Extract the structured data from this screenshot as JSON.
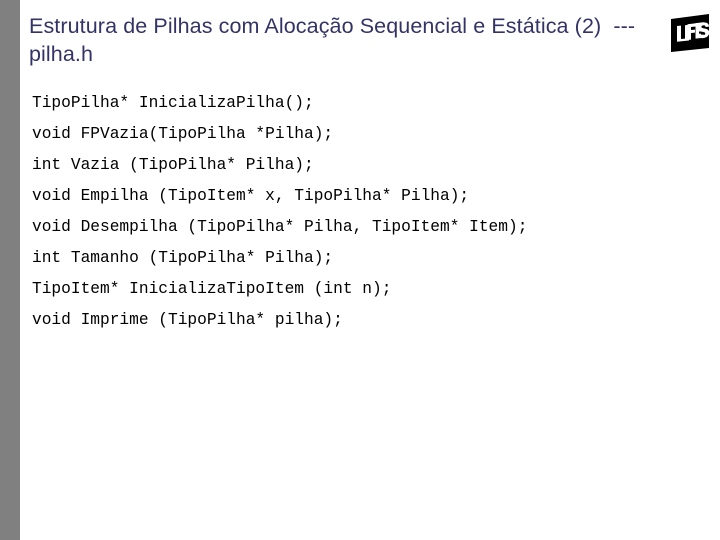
{
  "slide": {
    "title": "Estrutura de Pilhas com Alocação Sequencial e Estática (2)  --- pilha.h",
    "title_color": "#333366",
    "band_color": "#808080",
    "background_color": "#ffffff",
    "code_color": "#000000"
  },
  "logo": {
    "name": "ufes-logo",
    "text": "UFES"
  },
  "code": {
    "lines": [
      "TipoPilha* InicializaPilha();",
      "void FPVazia(TipoPilha *Pilha);",
      "int Vazia (TipoPilha* Pilha);",
      "void Empilha (TipoItem* x, TipoPilha* Pilha);",
      "void Desempilha (TipoPilha* Pilha, TipoItem* Item);",
      "int Tamanho (TipoPilha* Pilha);",
      "TipoItem* InicializaTipoItem (int n);",
      "void Imprime (TipoPilha* pilha);"
    ]
  }
}
